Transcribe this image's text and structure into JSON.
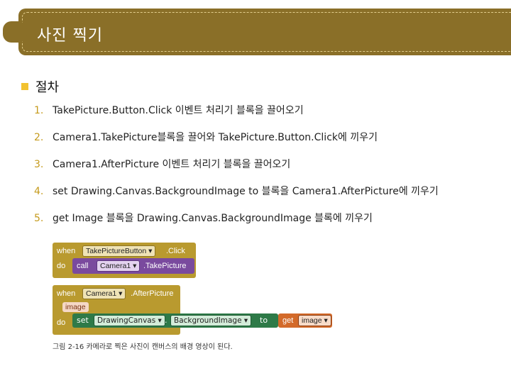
{
  "title": "사진 찍기",
  "section": "절차",
  "steps": [
    {
      "num": "1.",
      "text": "TakePicture.Button.Click 이벤트 처리기 블록을 끌어오기"
    },
    {
      "num": "2.",
      "text": "Camera1.TakePicture블록을 끌어와 TakePicture.Button.Click에 끼우기"
    },
    {
      "num": "3.",
      "text": "Camera1.AfterPicture 이벤트 처리기 블록을 끌어오기"
    },
    {
      "num": "4.",
      "text": "set Drawing.Canvas.BackgroundImage to 블록을 Camera1.AfterPicture에 끼우기"
    },
    {
      "num": "5.",
      "text": "get Image 블록을 Drawing.Canvas.BackgroundImage 블록에 끼우기"
    }
  ],
  "figure": {
    "block1": {
      "when": "when",
      "component": "TakePictureButton ▾",
      "event": ".Click",
      "do": "do",
      "call": "call",
      "target": "Camera1 ▾",
      "method": ".TakePicture"
    },
    "block2": {
      "when": "when",
      "component": "Camera1 ▾",
      "event": ".AfterPicture",
      "param": "image",
      "do": "do",
      "set": "set",
      "canvas": "DrawingCanvas ▾",
      "dot": ".",
      "property": "BackgroundImage ▾",
      "to": "to",
      "get": "get",
      "getvar": "image ▾"
    },
    "caption": "그림 2-16 카메라로 찍은 사진이 캔버스의 배경 영상이 된다."
  },
  "colors": {
    "banner": "#8a6f28",
    "bullet": "#f2c230",
    "event_block": "#b99a2f",
    "call_block": "#7a4a9e",
    "set_block": "#2e7a48",
    "get_block": "#d36a2a"
  }
}
